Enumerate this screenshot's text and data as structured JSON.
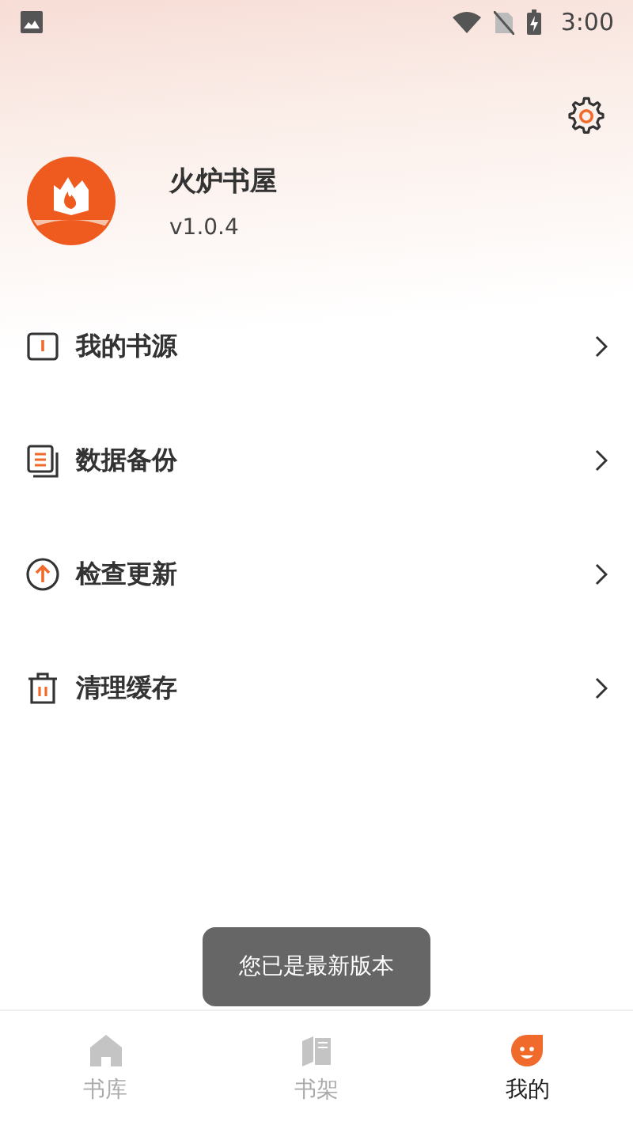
{
  "status_bar": {
    "time": "3:00"
  },
  "profile": {
    "app_name": "火炉书屋",
    "version": "v1.0.4"
  },
  "menu": [
    {
      "kind": "sources",
      "label": "我的书源"
    },
    {
      "kind": "backup",
      "label": "数据备份"
    },
    {
      "kind": "update",
      "label": "检查更新"
    },
    {
      "kind": "clear",
      "label": "清理缓存"
    }
  ],
  "toast": "您已是最新版本",
  "bottom_nav": [
    {
      "kind": "library",
      "label": "书库",
      "selected": false
    },
    {
      "kind": "shelf",
      "label": "书架",
      "selected": false
    },
    {
      "kind": "me",
      "label": "我的",
      "selected": true
    }
  ]
}
